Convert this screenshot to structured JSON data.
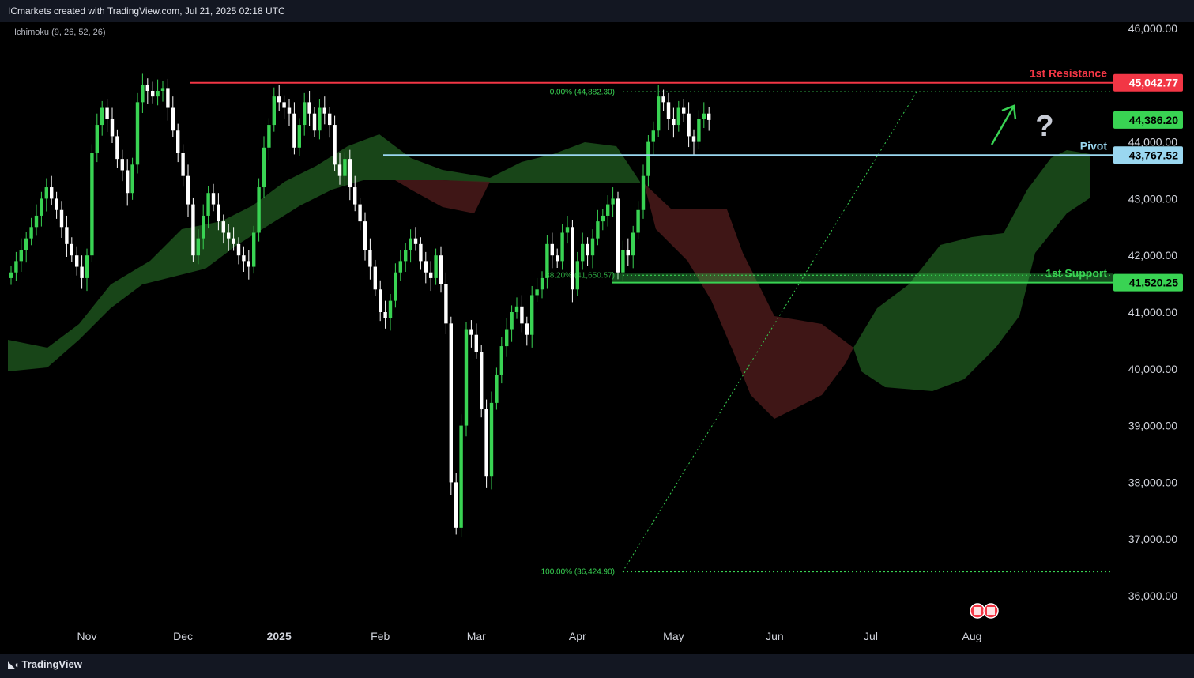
{
  "header": {
    "attribution": "ICmarkets created with TradingView.com, Jul 21, 2025 02:18 UTC",
    "indicator": "Ichimoku (9, 26, 52, 26)"
  },
  "footer": {
    "brand": "TradingView"
  },
  "colors": {
    "bull": "#39d353",
    "bear": "#ffffff",
    "resistance": "#f23645",
    "pivot": "#9ad7f0",
    "support": "#39d353",
    "cloud_bull": "#1b4d1b",
    "cloud_bear": "#4a1a1a",
    "fib": "#39d353"
  },
  "chart_data": {
    "type": "candlestick",
    "ylim": [
      35700,
      46200
    ],
    "y_ticks": [
      {
        "value": 46000,
        "label": "46,000.00"
      },
      {
        "value": 44000,
        "label": "44,000.00"
      },
      {
        "value": 43000,
        "label": "43,000.00"
      },
      {
        "value": 42000,
        "label": "42,000.00"
      },
      {
        "value": 41000,
        "label": "41,000.00"
      },
      {
        "value": 40000,
        "label": "40,000.00"
      },
      {
        "value": 39000,
        "label": "39,000.00"
      },
      {
        "value": 38000,
        "label": "38,000.00"
      },
      {
        "value": 37000,
        "label": "37,000.00"
      },
      {
        "value": 36000,
        "label": "36,000.00"
      }
    ],
    "x_ticks": [
      {
        "label": "Nov",
        "bar": 15,
        "bold": false
      },
      {
        "label": "Dec",
        "bar": 34,
        "bold": false
      },
      {
        "label": "2025",
        "bar": 53,
        "bold": true
      },
      {
        "label": "Feb",
        "bar": 73,
        "bold": false
      },
      {
        "label": "Mar",
        "bar": 92,
        "bold": false
      },
      {
        "label": "Apr",
        "bar": 112,
        "bold": false
      },
      {
        "label": "May",
        "bar": 131,
        "bold": false
      },
      {
        "label": "Jun",
        "bar": 151,
        "bold": false
      },
      {
        "label": "Jul",
        "bar": 170,
        "bold": false
      },
      {
        "label": "Aug",
        "bar": 190,
        "bold": false
      }
    ],
    "levels": {
      "resistance": {
        "value": 45042.77,
        "label": "1st Resistance",
        "tag": "45,042.77"
      },
      "pivot": {
        "value": 43767.52,
        "label": "Pivot",
        "tag": "43,767.52"
      },
      "support": {
        "value": 41520.25,
        "label": "1st Support",
        "tag": "41,520.25"
      },
      "last_price": {
        "value": 44386.2,
        "tag": "44,386.20"
      }
    },
    "fibonacci": {
      "high": {
        "value": 44882.3,
        "label": "0.00% (44,882.30)"
      },
      "low": {
        "value": 36424.9,
        "label": "100.00% (36,424.90)"
      },
      "mid": {
        "value": 41650.57,
        "label": "38.20% (41,650.57)"
      }
    },
    "annotation": "?",
    "closes": [
      41700,
      41900,
      42100,
      42300,
      42500,
      42700,
      43000,
      43200,
      43000,
      42800,
      42500,
      42200,
      42000,
      41800,
      41600,
      42000,
      43800,
      44300,
      44600,
      44400,
      44100,
      43700,
      43500,
      43100,
      43600,
      44700,
      45000,
      44900,
      44800,
      44900,
      44950,
      44600,
      44200,
      43800,
      43400,
      42900,
      42000,
      42300,
      42700,
      43100,
      42900,
      42600,
      42400,
      42300,
      42200,
      42000,
      41900,
      41800,
      42400,
      43200,
      43900,
      44300,
      44800,
      44700,
      44600,
      44500,
      43900,
      44300,
      44700,
      44500,
      44200,
      44600,
      44500,
      44300,
      43600,
      43400,
      43700,
      43200,
      42900,
      42600,
      42100,
      41800,
      41400,
      41000,
      40900,
      41200,
      41700,
      41900,
      42100,
      42300,
      42200,
      41900,
      41700,
      41600,
      42000,
      41500,
      40800,
      38000,
      37200,
      39000,
      40700,
      40600,
      40300,
      39300,
      38100,
      39400,
      39900,
      40400,
      40700,
      41000,
      41100,
      40800,
      40600,
      41300,
      41400,
      41600,
      42200,
      42000,
      41900,
      42400,
      42500,
      41400,
      41900,
      42200,
      42000,
      42300,
      42600,
      42700,
      42900,
      43000,
      41700,
      42100,
      42000,
      42400,
      42800,
      43400,
      44000,
      44200,
      44800,
      44700,
      44400,
      44300,
      44600,
      44500,
      44100,
      44000,
      44400,
      44500,
      44386
    ]
  }
}
